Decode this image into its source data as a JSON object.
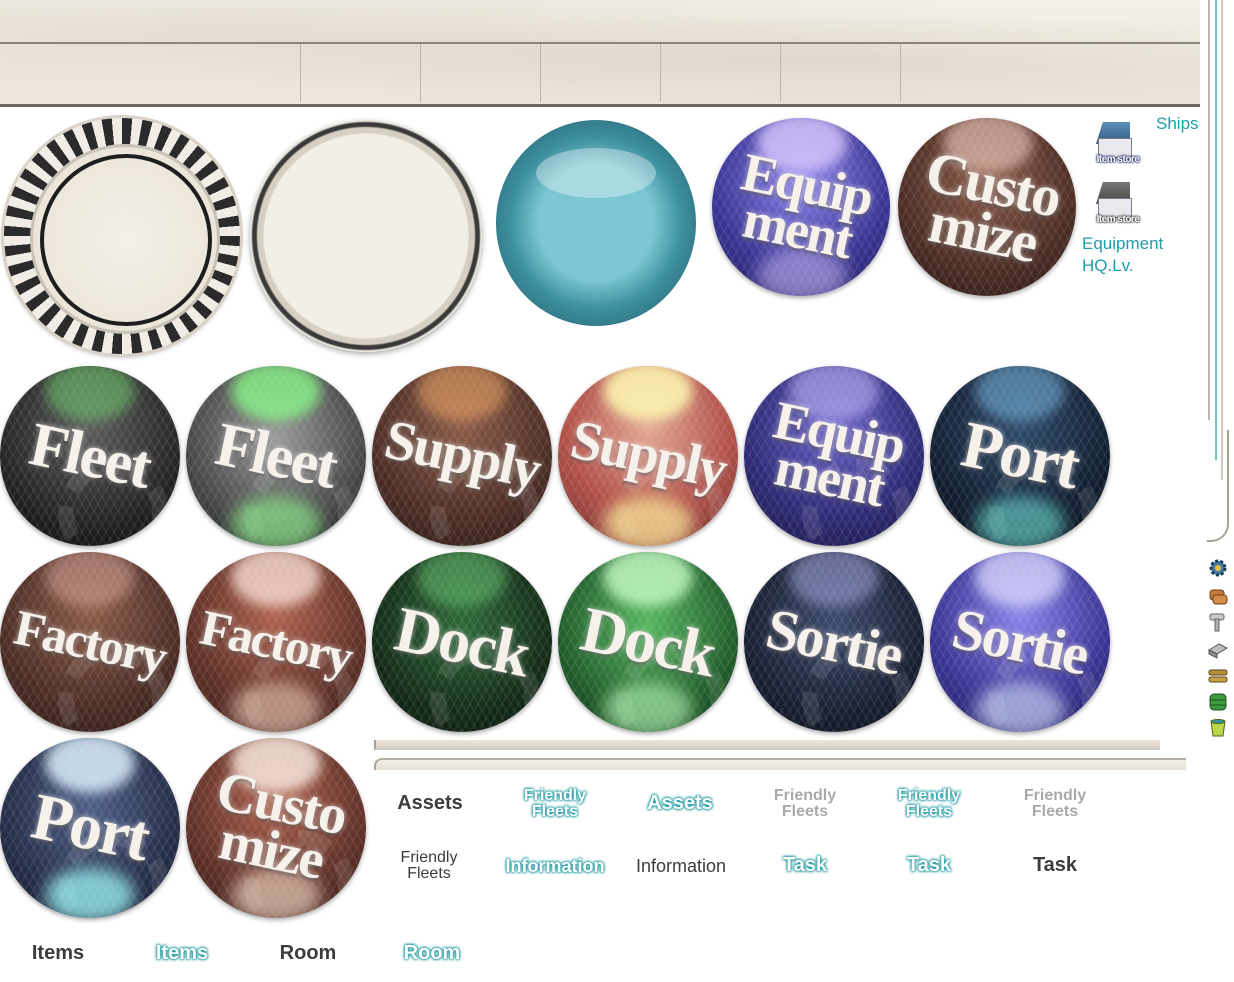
{
  "colors": {
    "teal": "#1c9ea8",
    "gray_text": "#3c3c3c",
    "faded_text": "#a9a9a9"
  },
  "header": {
    "ships_label": "Ships",
    "equipment_label": "Equipment",
    "hq_label": "HQ.Lv."
  },
  "item_store": {
    "label_1": "Item store",
    "label_2": "Item store"
  },
  "orbs_top": [
    {
      "id": "equipment-top",
      "lines": [
        "Equip",
        "ment"
      ]
    },
    {
      "id": "customize-top",
      "lines": [
        "Custo",
        "mize"
      ]
    }
  ],
  "orbs_row1": [
    {
      "id": "fleet",
      "lines": [
        "Fleet"
      ]
    },
    {
      "id": "fleet-hover",
      "lines": [
        "Fleet"
      ]
    },
    {
      "id": "supply",
      "lines": [
        "Supply"
      ]
    },
    {
      "id": "supply-hover",
      "lines": [
        "Supply"
      ]
    },
    {
      "id": "equipment",
      "lines": [
        "Equip",
        "ment"
      ]
    },
    {
      "id": "port",
      "lines": [
        "Port"
      ]
    }
  ],
  "orbs_row2": [
    {
      "id": "factory",
      "lines": [
        "Factory"
      ]
    },
    {
      "id": "factory-hover",
      "lines": [
        "Factory"
      ]
    },
    {
      "id": "dock",
      "lines": [
        "Dock"
      ]
    },
    {
      "id": "dock-hover",
      "lines": [
        "Dock"
      ]
    },
    {
      "id": "sortie",
      "lines": [
        "Sortie"
      ]
    },
    {
      "id": "sortie-hover",
      "lines": [
        "Sortie"
      ]
    }
  ],
  "orbs_row3": [
    {
      "id": "port-hover",
      "lines": [
        "Port"
      ]
    },
    {
      "id": "customize-hover",
      "lines": [
        "Custo",
        "mize"
      ]
    }
  ],
  "tabs_row1": [
    {
      "text": "Assets",
      "style": "gray"
    },
    {
      "text": "Friendly Fleets",
      "style": "teal"
    },
    {
      "text": "Assets",
      "style": "teal"
    },
    {
      "text": "Friendly Fleets",
      "style": "faded"
    },
    {
      "text": "Friendly Fleets",
      "style": "teal"
    },
    {
      "text": "Friendly Fleets",
      "style": "faded"
    }
  ],
  "tabs_row2": [
    {
      "text": "Friendly Fleets",
      "style": "gray"
    },
    {
      "text": "Information",
      "style": "teal"
    },
    {
      "text": "Information",
      "style": "gray"
    },
    {
      "text": "Task",
      "style": "teal"
    },
    {
      "text": "Task",
      "style": "teal"
    },
    {
      "text": "Task",
      "style": "gray"
    }
  ],
  "tabs_row3": [
    {
      "text": "Items",
      "style": "gray"
    },
    {
      "text": "Items",
      "style": "teal"
    },
    {
      "text": "Room",
      "style": "gray"
    },
    {
      "text": "Room",
      "style": "teal"
    }
  ],
  "resource_icons": [
    "settings-icon",
    "fuel-icon",
    "bolt-icon",
    "steel-icon",
    "ammo-icon",
    "bauxite-icon",
    "bucket-icon"
  ]
}
